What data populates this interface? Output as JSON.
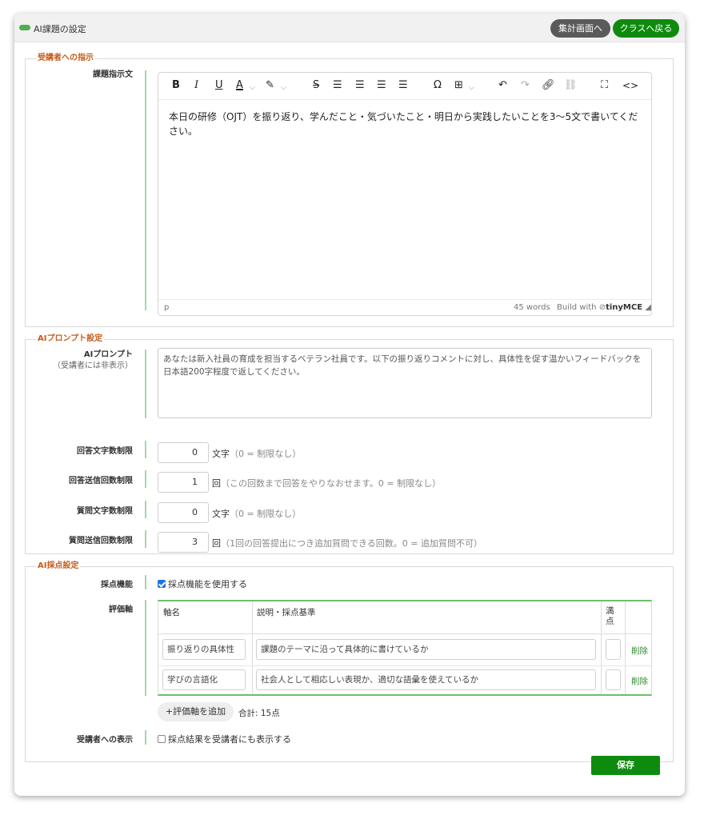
{
  "header": {
    "title": "AI課題の設定",
    "summary_button": "集計画面へ",
    "back_button": "クラスへ戻る",
    "status_color": "#4caf50"
  },
  "instructions": {
    "legend": "受講者への指示",
    "label": "課題指示文",
    "editor": {
      "toolbar": {
        "bold": "B",
        "italic": "I",
        "underline": "U",
        "font_color": "A",
        "strike": "S",
        "special_char": "Ω",
        "code": "<>"
      },
      "content": "本日の研修（OJT）を振り返り、学んだこと・気づいたこと・明日から実践したいことを3～5文で書いてください。",
      "path": "p",
      "word_count": "45 words",
      "build_with": "Build with",
      "brand": "tinyMCE"
    }
  },
  "prompt": {
    "legend": "AIプロンプト設定",
    "prompt_label": "AIプロンプト",
    "prompt_sublabel": "（受講者には非表示）",
    "prompt_text": "あなたは新入社員の育成を担当するベテラン社員です。以下の振り返りコメントに対し、具体性を促す温かいフィードバックを日本語200字程度で返してください。",
    "answer_chars": {
      "label": "回答文字数制限",
      "value": "0",
      "unit": "文字",
      "hint": "（0 = 制限なし）"
    },
    "answer_sends": {
      "label": "回答送信回数制限",
      "value": "1",
      "unit": "回",
      "hint": "（この回数まで回答をやりなおせます。0 = 制限なし）"
    },
    "question_chars": {
      "label": "質問文字数制限",
      "value": "0",
      "unit": "文字",
      "hint": "（0 = 制限なし）"
    },
    "question_sends": {
      "label": "質問送信回数制限",
      "value": "3",
      "unit": "回",
      "hint": "（1回の回答提出につき追加質問できる回数。0 = 追加質問不可）"
    }
  },
  "scoring": {
    "legend": "AI採点設定",
    "feature_label": "採点機能",
    "use_scoring": "採点機能を使用する",
    "axis_label": "評価軸",
    "table": {
      "headers": {
        "name": "軸名",
        "desc": "説明・採点基準",
        "max": "満点"
      },
      "rows": [
        {
          "name": "振り返りの具体性",
          "desc": "課題のテーマに沿って具体的に書けているか",
          "delete": "削除"
        },
        {
          "name": "学びの言語化",
          "desc": "社会人として相応しい表現か、適切な語彙を使えているか",
          "delete": "削除"
        }
      ]
    },
    "add_axis": "+評価軸を追加",
    "total": "合計: 15点",
    "display_label": "受講者への表示",
    "show_results": "採点結果を受講者にも表示する"
  },
  "footer": {
    "save": "保存"
  }
}
